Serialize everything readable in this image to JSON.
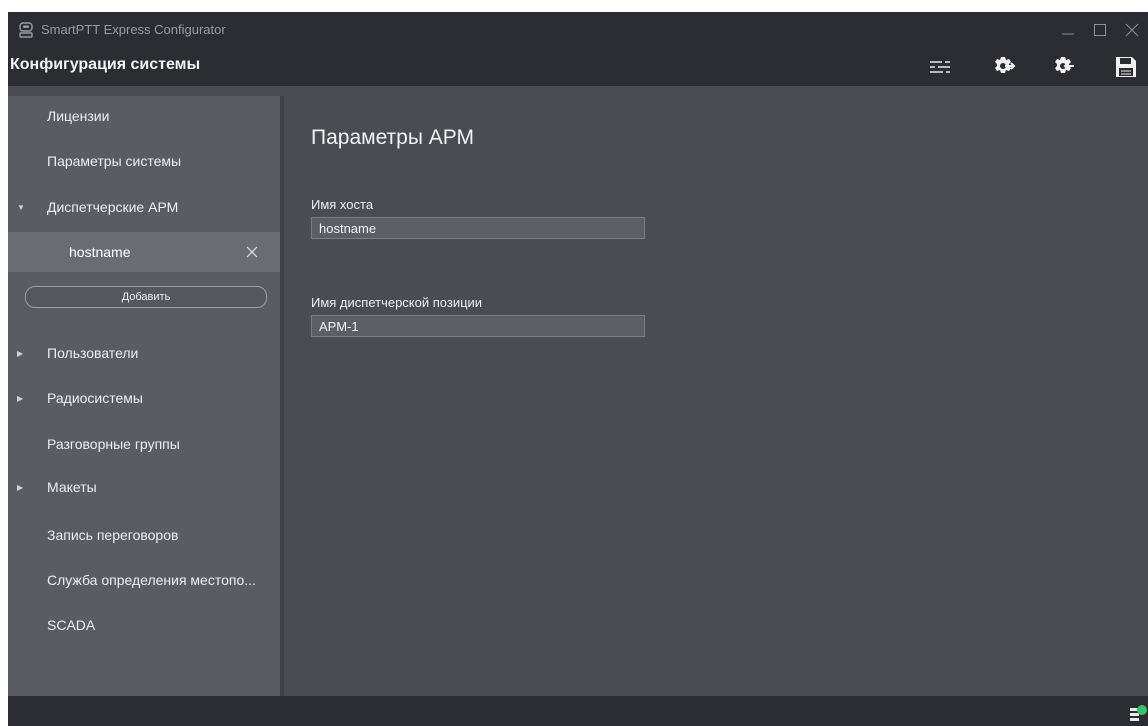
{
  "window": {
    "title": "SmartPTT Express Configurator"
  },
  "header": {
    "title": "Конфигурация системы",
    "toolbar": {
      "icons": [
        "settings-sliders-icon",
        "export-config-icon",
        "import-config-icon",
        "save-icon"
      ]
    }
  },
  "sidebar": {
    "items": [
      {
        "label": "Лицензии"
      },
      {
        "label": "Параметры системы"
      },
      {
        "label": "Диспетчерские АРМ"
      },
      {
        "label": "Пользователи"
      },
      {
        "label": "Радиосистемы"
      },
      {
        "label": "Разговорные группы"
      },
      {
        "label": "Макеты"
      },
      {
        "label": "Запись переговоров"
      },
      {
        "label": "Служба определения местопо..."
      },
      {
        "label": "SCADA"
      }
    ],
    "selected_subitem": "hostname",
    "add_label": "Добавить"
  },
  "main": {
    "title": "Параметры АРМ",
    "fields": [
      {
        "label": "Имя хоста",
        "value": "hostname"
      },
      {
        "label": "Имя диспетчерской позиции",
        "value": "АРМ-1"
      }
    ]
  },
  "colors": {
    "titlebar": "#2b2d33",
    "sidebar": "#5a5c63",
    "sidebar_selected": "#6a6c73",
    "main": "#4a4c54",
    "status_accent": "#37c36b"
  }
}
